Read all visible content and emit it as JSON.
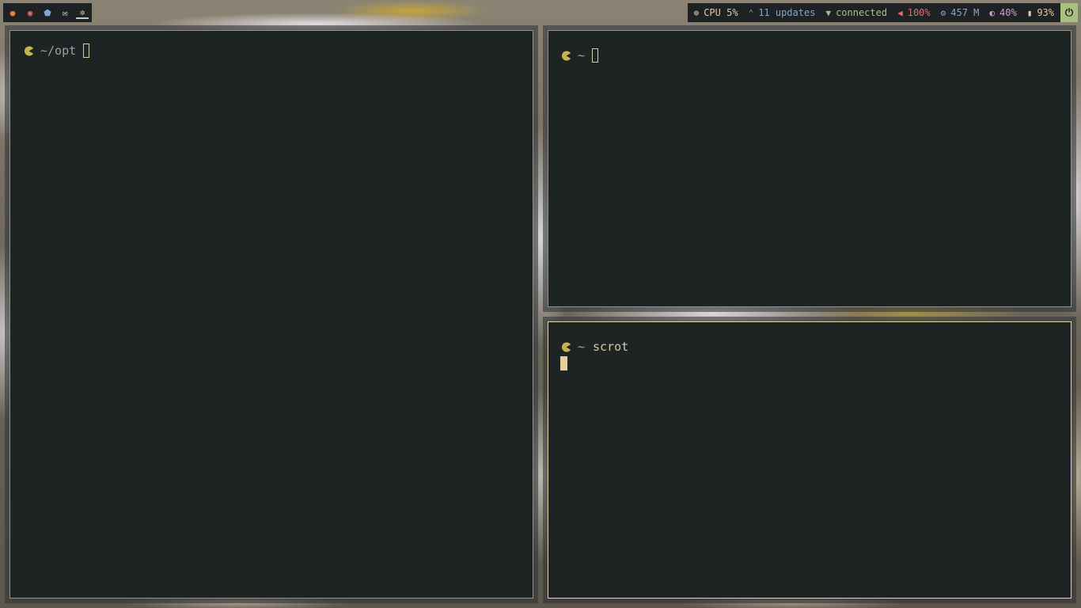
{
  "launcher": {
    "icons": [
      {
        "name": "firefox-icon",
        "glyph": "●",
        "color": "#e8803a"
      },
      {
        "name": "chromium-icon",
        "glyph": "◉",
        "color": "#e06c75"
      },
      {
        "name": "shield-icon",
        "glyph": "⬟",
        "color": "#7fa7d8"
      },
      {
        "name": "mail-icon",
        "glyph": "✉",
        "color": "#d0d0d0"
      },
      {
        "name": "settings-icon",
        "glyph": "✲",
        "color": "#e8d9a8"
      }
    ]
  },
  "statusbar": {
    "cpu": {
      "icon": "⊕",
      "text": "CPU 5%",
      "color": "#d8caac"
    },
    "updates": {
      "icon": "⌃",
      "text": "11 updates",
      "color": "#83a6c8"
    },
    "network": {
      "icon": "▼",
      "text": "connected",
      "color": "#a7c080"
    },
    "volume": {
      "icon": "◀",
      "text": "100%",
      "color": "#e06c75"
    },
    "memory": {
      "icon": "⚙",
      "text": "457 M",
      "color": "#83a6c8"
    },
    "brightness": {
      "icon": "◐",
      "text": "40%",
      "color": "#d09ccf"
    },
    "battery": {
      "icon": "▮",
      "text": "93%",
      "color": "#d8caac"
    },
    "power_icon": "⏻"
  },
  "terminals": {
    "left": {
      "path": "~/opt",
      "command": ""
    },
    "top_right": {
      "path": "~",
      "command": ""
    },
    "bottom_right": {
      "path": "~",
      "command": "scrot"
    }
  },
  "colors": {
    "terminal_bg": "#1e2324",
    "prompt_icon": "#c6b54a",
    "focus_border": "#e0d2a6",
    "bar_bg": "#1e2224"
  }
}
